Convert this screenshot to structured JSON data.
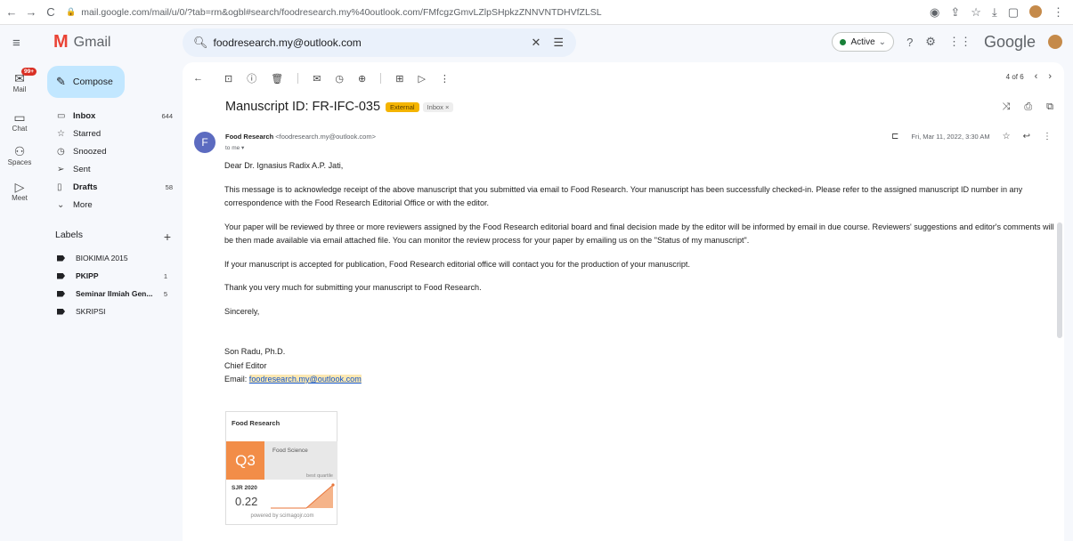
{
  "browser": {
    "url": "mail.google.com/mail/u/0/?tab=rm&ogbl#search/foodresearch.my%40outlook.com/FMfcgzGmvLZlpSHpkzZNNVNTDHVfZLSL"
  },
  "app": {
    "name": "Gmail",
    "search_value": "foodresearch.my@outlook.com",
    "status": "Active",
    "brand": "Google"
  },
  "rail": {
    "mail": "Mail",
    "mail_badge": "99+",
    "chat": "Chat",
    "spaces": "Spaces",
    "meet": "Meet"
  },
  "sidebar": {
    "compose": "Compose",
    "folders": [
      {
        "label": "Inbox",
        "count": "644",
        "icon": "inbox-icon"
      },
      {
        "label": "Starred",
        "count": "",
        "icon": "star-icon"
      },
      {
        "label": "Snoozed",
        "count": "",
        "icon": "clock-icon"
      },
      {
        "label": "Sent",
        "count": "",
        "icon": "send-icon"
      },
      {
        "label": "Drafts",
        "count": "58",
        "icon": "draft-icon"
      },
      {
        "label": "More",
        "count": "",
        "icon": "chevron-down-icon"
      }
    ],
    "labels_title": "Labels",
    "labels": [
      {
        "label": "BIOKIMIA 2015",
        "count": ""
      },
      {
        "label": "PKIPP",
        "count": "1"
      },
      {
        "label": "Seminar Ilmiah Gen...",
        "count": "5"
      },
      {
        "label": "SKRIPSI",
        "count": ""
      }
    ]
  },
  "toolbar": {
    "pager": "4 of 6"
  },
  "email": {
    "subject": "Manuscript ID: FR-IFC-035",
    "chip_external": "External",
    "chip_inbox": "Inbox ×",
    "sender_name": "Food Research",
    "sender_email": "<foodresearch.my@outlook.com>",
    "to": "to me ▾",
    "avatar_letter": "F",
    "date": "Fri, Mar 11, 2022, 3:30 AM",
    "greeting": "Dear Dr. Ignasius Radix A.P. Jati,",
    "p1": "This message is to acknowledge receipt of the above manuscript that you submitted via email to Food Research. Your manuscript has been successfully checked-in. Please refer to the assigned manuscript ID number in any correspondence with the Food Research Editorial Office or with the editor.",
    "p2": "Your paper will be reviewed by three or more reviewers assigned by the Food Research editorial board and final decision made by the editor will be informed by email in due course. Reviewers' suggestions and editor's comments will be then made available via email attached file. You can monitor the review process for your paper by emailing us on the \"Status of my manuscript\".",
    "p3": "If your manuscript is accepted for publication, Food Research editorial office will contact you for the production of your manuscript.",
    "p4": "Thank you very much for submitting your manuscript to Food Research.",
    "closing": "Sincerely,",
    "sig_name": "Son Radu, Ph.D.",
    "sig_title": "Chief Editor",
    "sig_email_label": "Email:",
    "sig_email": "foodresearch.my@outlook.com"
  },
  "sjr_widget": {
    "journal": "Food Research",
    "quartile": "Q3",
    "category": "Food Science",
    "quartile_note": "best quartile",
    "year": "SJR 2020",
    "value": "0.22",
    "powered": "powered by scimagojr.com"
  }
}
